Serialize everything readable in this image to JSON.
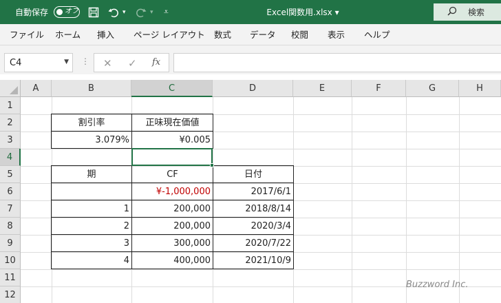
{
  "titlebar": {
    "autosave_label": "自動保存",
    "autosave_state": "オフ",
    "filename": "Excel関数用.xlsx ▾",
    "search_label": "検索"
  },
  "menu": [
    "ファイル",
    "ホーム",
    "挿入",
    "ページ レイアウト",
    "数式",
    "データ",
    "校閲",
    "表示",
    "ヘルプ"
  ],
  "formula_bar": {
    "name_box": "C4",
    "formula": ""
  },
  "columns": [
    "A",
    "B",
    "C",
    "D",
    "E",
    "F",
    "G",
    "H"
  ],
  "rows": [
    "1",
    "2",
    "3",
    "4",
    "5",
    "6",
    "7",
    "8",
    "9",
    "10",
    "11",
    "12"
  ],
  "cells": {
    "B2": "割引率",
    "C2": "正味現在価値",
    "B3": "3.079%",
    "C3": "¥0.005",
    "B5": "期",
    "C5": "CF",
    "D5": "日付",
    "C6": "¥-1,000,000",
    "D6": "2017/6/1",
    "B7": "1",
    "C7": "200,000",
    "D7": "2018/8/14",
    "B8": "2",
    "C8": "200,000",
    "D8": "2020/3/4",
    "B9": "3",
    "C9": "300,000",
    "D9": "2020/7/22",
    "B10": "4",
    "C10": "400,000",
    "D10": "2021/10/9"
  },
  "watermark": "Buzzword Inc."
}
